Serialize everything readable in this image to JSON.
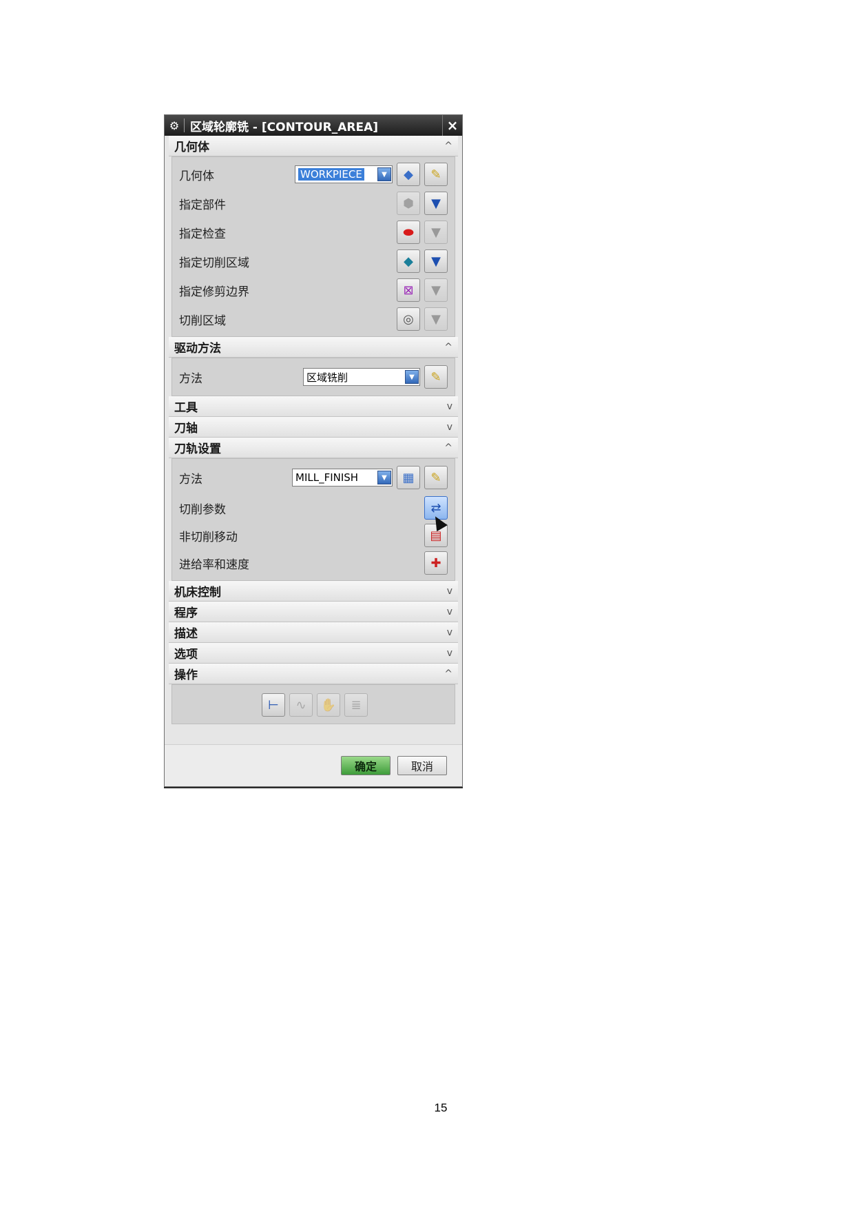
{
  "dialog": {
    "title": "区域轮廓铣 - [CONTOUR_AREA]",
    "close_symbol": "×",
    "sections": {
      "geometry": {
        "label": "几何体",
        "state": "expanded"
      },
      "drive": {
        "label": "驱动方法",
        "state": "expanded"
      },
      "tool": {
        "label": "工具",
        "state": "collapsed"
      },
      "axis": {
        "label": "刀轴",
        "state": "collapsed"
      },
      "path": {
        "label": "刀轨设置",
        "state": "expanded"
      },
      "machine": {
        "label": "机床控制",
        "state": "collapsed"
      },
      "program": {
        "label": "程序",
        "state": "collapsed"
      },
      "description": {
        "label": "描述",
        "state": "collapsed"
      },
      "options": {
        "label": "选项",
        "state": "collapsed"
      },
      "actions": {
        "label": "操作",
        "state": "expanded"
      }
    },
    "geometry": {
      "geometry_label": "几何体",
      "geometry_value": "WORKPIECE",
      "part_label": "指定部件",
      "check_label": "指定检查",
      "cut_area_label": "指定切削区域",
      "trim_label": "指定修剪边界",
      "cut_region_label": "切削区域"
    },
    "drive": {
      "method_label": "方法",
      "method_value": "区域铣削"
    },
    "path": {
      "method_label": "方法",
      "method_value": "MILL_FINISH",
      "cut_params_label": "切削参数",
      "noncut_label": "非切削移动",
      "feeds_label": "进给率和速度"
    },
    "buttons": {
      "ok": "确定",
      "cancel": "取消"
    },
    "chevrons": {
      "up": "^",
      "down": "v"
    }
  },
  "page": {
    "number": "15"
  }
}
